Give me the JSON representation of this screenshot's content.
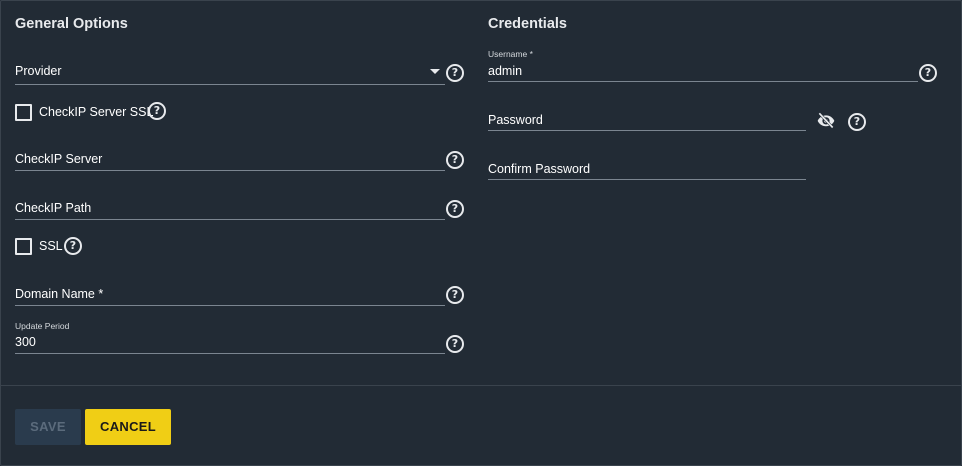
{
  "general": {
    "title": "General Options",
    "provider_label": "Provider",
    "checkip_ssl_label": "CheckIP Server SSL",
    "checkip_server_label": "CheckIP Server",
    "checkip_path_label": "CheckIP Path",
    "ssl_label": "SSL",
    "domain_name_label": "Domain Name *",
    "update_period_label": "Update Period",
    "update_period_value": "300"
  },
  "credentials": {
    "title": "Credentials",
    "username_label": "Username *",
    "username_value": "admin",
    "password_label": "Password",
    "confirm_password_label": "Confirm Password"
  },
  "actions": {
    "save_label": "SAVE",
    "cancel_label": "CANCEL"
  },
  "icons": {
    "help": "help-circle-icon",
    "dropdown": "caret-down-icon",
    "visibility": "eye-off-icon"
  },
  "colors": {
    "background": "#222b35",
    "accent": "#f0ce15",
    "save_disabled_bg": "#2a3b4d"
  }
}
